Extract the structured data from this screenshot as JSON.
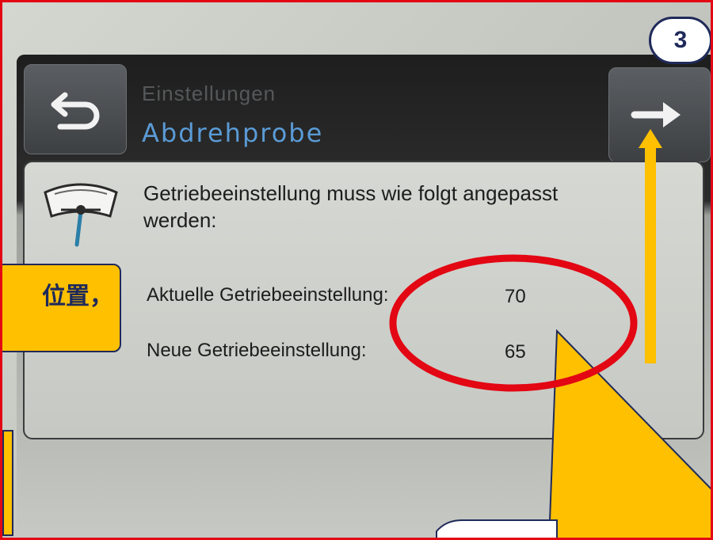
{
  "app": {
    "breadcrumb_parent": "Einstellungen",
    "page_title": "Abdrehprobe"
  },
  "toolbar": {
    "back_icon": "return-arrow-icon",
    "next_icon": "right-arrow-icon"
  },
  "content": {
    "instruction": "Getriebeeinstellung muss wie folgt angepasst werden:",
    "rows": [
      {
        "label": "Aktuelle Getriebeeinstellung:",
        "value": "70"
      },
      {
        "label": "Neue Getriebeeinstellung:",
        "value": "65"
      }
    ],
    "icon": "calibration-gauge-icon"
  },
  "annotations": {
    "step_number": "3",
    "callout_text": "位置，",
    "accent_color": "#ffc000",
    "highlight_color": "#e30613",
    "outline_color": "#1f2a5a"
  }
}
